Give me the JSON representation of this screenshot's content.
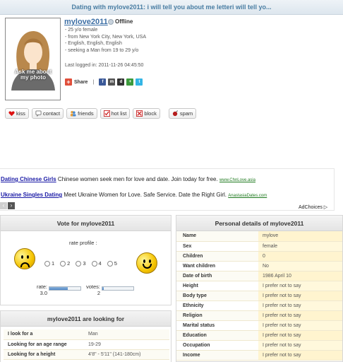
{
  "header": {
    "title": "Dating with mylove2011: i will tell you about me letteri will tell yo..."
  },
  "profile": {
    "ask_photo": "Ask me about my photo",
    "username": "mylove2011",
    "status": "Offline",
    "details": [
      "- 25 y/o female",
      "- from New York City, New York, USA",
      "- English, English, English",
      "- seeking a Man from 19 to 29 y/o"
    ],
    "last_logged": "Last logged in: 2011-11-26 04:45:50",
    "share_label": "Share"
  },
  "actions": {
    "kiss": "kiss",
    "contact": "contact",
    "friends": "friends",
    "hotlist": "hot list",
    "block": "block",
    "spam": "spam"
  },
  "ads": [
    {
      "title": "Dating Chinese Girls",
      "text": "Chinese women seek men for love and date. Join today for free.",
      "url": "www.ChnLove.asia"
    },
    {
      "title": "Ukraine Singles Dating",
      "text": "Meet Ukraine Women for Love. Safe Service. Date the Right Girl.",
      "url": "AnastasiaDates.com"
    }
  ],
  "adchoices": "AdChoices ▷",
  "vote": {
    "title": "Vote for mylove2011",
    "rate_profile": "rate profile :",
    "options": [
      "1",
      "2",
      "3",
      "4",
      "5"
    ],
    "rate_label": "rate:",
    "rate_value": "3.0",
    "rate_fraction": 0.6,
    "votes_label": "votes:",
    "votes_value": "2",
    "votes_fraction": 0.05
  },
  "looking_for": {
    "title": "mylove2011 are looking for",
    "rows": [
      {
        "k": "I look for a",
        "v": "Man"
      },
      {
        "k": "Looking for an age range",
        "v": "19-29"
      },
      {
        "k": "Looking for a height",
        "v": "4'8\" - 5'11\" (141-180cm)"
      }
    ]
  },
  "personal": {
    "title": "Personal details of mylove2011",
    "rows": [
      {
        "k": "Name",
        "v": "mylove"
      },
      {
        "k": "Sex",
        "v": "female"
      },
      {
        "k": "Children",
        "v": "0"
      },
      {
        "k": "Want children",
        "v": "No"
      },
      {
        "k": "Date of birth",
        "v": "1986 April 10"
      },
      {
        "k": "Height",
        "v": "I prefer not to say"
      },
      {
        "k": "Body type",
        "v": "I prefer not to say"
      },
      {
        "k": "Ethnicity",
        "v": "I prefer not to say"
      },
      {
        "k": "Religion",
        "v": "I prefer not to say"
      },
      {
        "k": "Marital status",
        "v": "I prefer not to say"
      },
      {
        "k": "Education",
        "v": "I prefer not to say"
      },
      {
        "k": "Occupation",
        "v": "I prefer not to say"
      },
      {
        "k": "Income",
        "v": "I prefer not to say"
      }
    ]
  }
}
